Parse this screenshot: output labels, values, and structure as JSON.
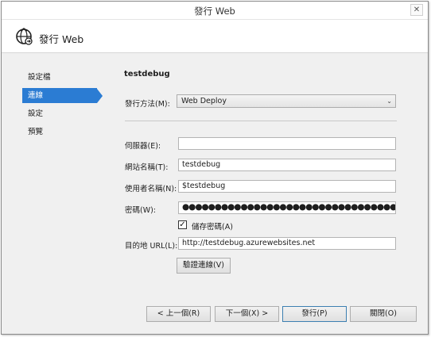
{
  "window": {
    "title": "發行 Web",
    "close_glyph": "✕"
  },
  "header": {
    "icon": "globe-publish-icon",
    "title": "發行 Web"
  },
  "sidebar": {
    "items": [
      {
        "label": "設定檔",
        "active": false
      },
      {
        "label": "連線",
        "active": true
      },
      {
        "label": "設定",
        "active": false
      },
      {
        "label": "預覽",
        "active": false
      }
    ]
  },
  "profile": {
    "name": "testdebug"
  },
  "form": {
    "method_label": "發行方法(M):",
    "method_value": "Web Deploy",
    "server_label": "伺服器(E):",
    "server_value": "",
    "site_label": "網站名稱(T):",
    "site_value": "testdebug",
    "user_label": "使用者名稱(N):",
    "user_value": "$testdebug",
    "password_label": "密碼(W):",
    "password_value": "●●●●●●●●●●●●●●●●●●●●●●●●●●●●●●●●●●●●●●●●●●●●●●",
    "save_password_label": "儲存密碼(A)",
    "save_password_checked": true,
    "dest_url_label": "目的地 URL(L):",
    "dest_url_value": "http://testdebug.azurewebsites.net",
    "validate_button": "驗證連線(V)"
  },
  "footer": {
    "prev_button": "< 上一個(R)",
    "next_button": "下一個(X) >",
    "publish_button": "發行(P)",
    "close_button": "關閉(O)"
  },
  "colors": {
    "accent": "#2b7cd3"
  }
}
